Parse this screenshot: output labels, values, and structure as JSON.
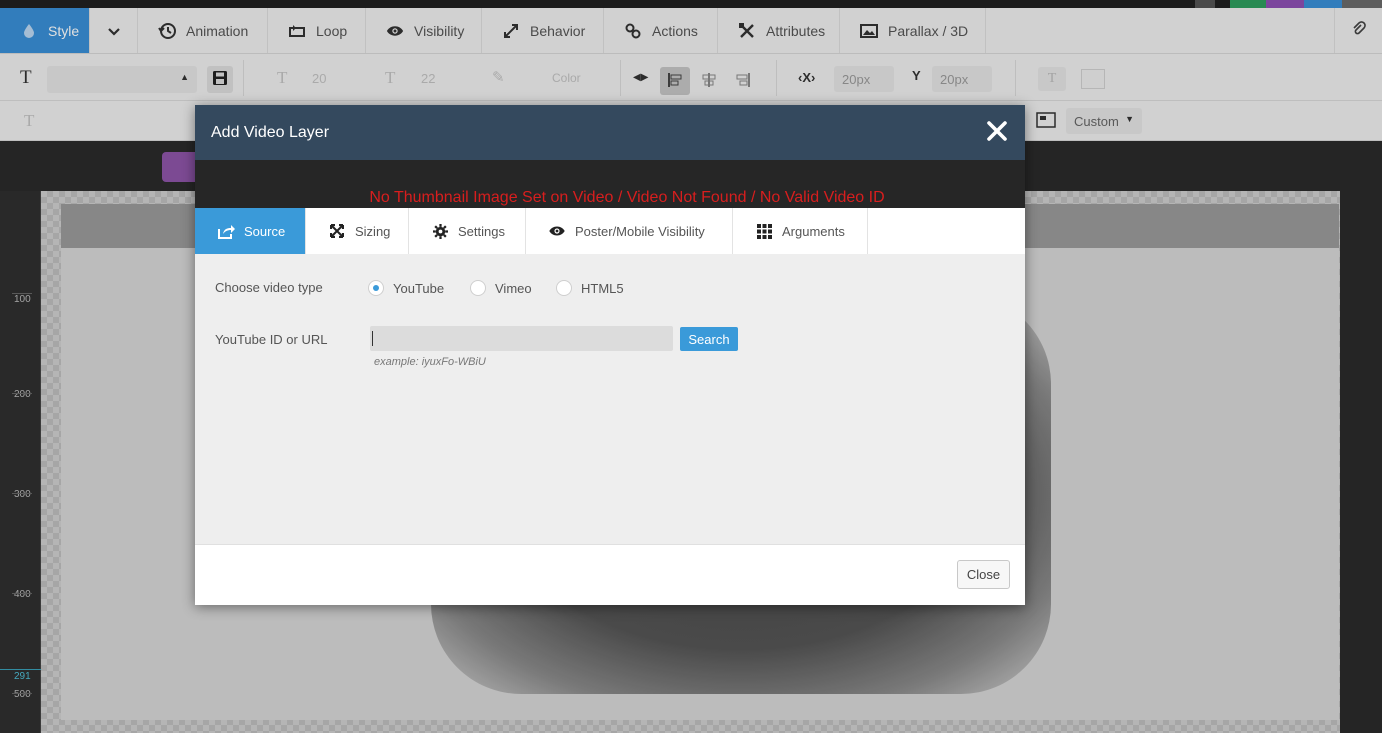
{
  "top_tabs": {
    "style": "Style",
    "animation": "Animation",
    "loop": "Loop",
    "visibility": "Visibility",
    "behavior": "Behavior",
    "actions": "Actions",
    "attributes": "Attributes",
    "parallax": "Parallax / 3D"
  },
  "toolbar": {
    "font_size": "20",
    "line_height": "22",
    "color_label": "Color",
    "x_label": "X",
    "x_value": "20px",
    "y_label": "Y",
    "y_value": "20px",
    "size_mode": "Custom"
  },
  "ruler": {
    "labels": [
      "100",
      "200",
      "300",
      "400",
      "500"
    ],
    "marker_value": "291"
  },
  "modal": {
    "title": "Add Video Layer",
    "preview_message": "No Thumbnail Image Set on Video / Video Not Found / No Valid Video ID",
    "tabs": [
      "Source",
      "Sizing",
      "Settings",
      "Poster/Mobile Visibility",
      "Arguments"
    ],
    "source": {
      "video_type_label": "Choose video type",
      "video_types": [
        "YouTube",
        "Vimeo",
        "HTML5"
      ],
      "selected_type": "YouTube",
      "id_label": "YouTube ID or URL",
      "id_value": "",
      "search_label": "Search",
      "example_text": "example: iyuxFo-WBiU"
    },
    "close_label": "Close"
  },
  "colors": {
    "accent": "#3a9ad9",
    "modal_header": "#34495e",
    "error_text": "#d81e1e"
  }
}
